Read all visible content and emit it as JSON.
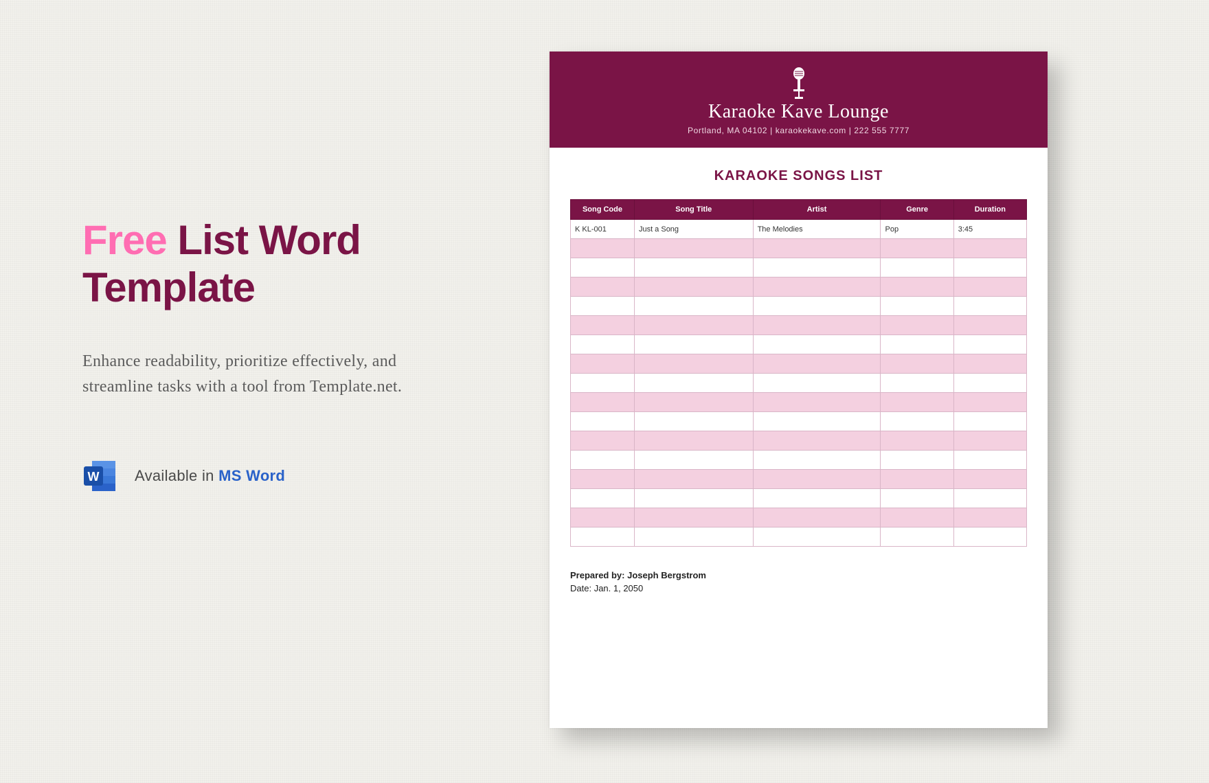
{
  "left": {
    "headline_free": "Free",
    "headline_rest": " List Word Template",
    "subtext": "Enhance readability, prioritize effectively, and streamline tasks with a tool from Template.net.",
    "available_prefix": "Available in ",
    "available_app": "MS Word"
  },
  "doc": {
    "brand_name": "Karaoke Kave Lounge",
    "brand_sub": "Portland, MA 04102 | karaokekave.com | 222 555 7777",
    "title": "KARAOKE SONGS LIST",
    "columns": [
      "Song Code",
      "Song Title",
      "Artist",
      "Genre",
      "Duration"
    ],
    "rows": [
      {
        "code": "K KL-001",
        "title": "Just a Song",
        "artist": "The Melodies",
        "genre": "Pop",
        "duration": "3:45"
      },
      {
        "code": "",
        "title": "",
        "artist": "",
        "genre": "",
        "duration": ""
      },
      {
        "code": "",
        "title": "",
        "artist": "",
        "genre": "",
        "duration": ""
      },
      {
        "code": "",
        "title": "",
        "artist": "",
        "genre": "",
        "duration": ""
      },
      {
        "code": "",
        "title": "",
        "artist": "",
        "genre": "",
        "duration": ""
      },
      {
        "code": "",
        "title": "",
        "artist": "",
        "genre": "",
        "duration": ""
      },
      {
        "code": "",
        "title": "",
        "artist": "",
        "genre": "",
        "duration": ""
      },
      {
        "code": "",
        "title": "",
        "artist": "",
        "genre": "",
        "duration": ""
      },
      {
        "code": "",
        "title": "",
        "artist": "",
        "genre": "",
        "duration": ""
      },
      {
        "code": "",
        "title": "",
        "artist": "",
        "genre": "",
        "duration": ""
      },
      {
        "code": "",
        "title": "",
        "artist": "",
        "genre": "",
        "duration": ""
      },
      {
        "code": "",
        "title": "",
        "artist": "",
        "genre": "",
        "duration": ""
      },
      {
        "code": "",
        "title": "",
        "artist": "",
        "genre": "",
        "duration": ""
      },
      {
        "code": "",
        "title": "",
        "artist": "",
        "genre": "",
        "duration": ""
      },
      {
        "code": "",
        "title": "",
        "artist": "",
        "genre": "",
        "duration": ""
      },
      {
        "code": "",
        "title": "",
        "artist": "",
        "genre": "",
        "duration": ""
      },
      {
        "code": "",
        "title": "",
        "artist": "",
        "genre": "",
        "duration": ""
      }
    ],
    "prepared_label": "Prepared by: ",
    "prepared_by": "Joseph Bergstrom",
    "date_label": "Date: ",
    "date_value": "Jan. 1, 2050"
  }
}
